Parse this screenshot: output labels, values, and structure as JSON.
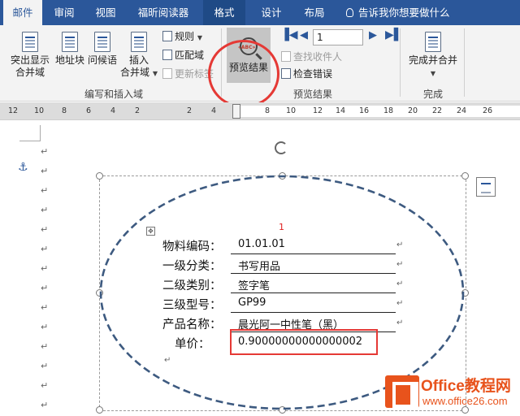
{
  "tabs": [
    {
      "label": "邮件",
      "active": true
    },
    {
      "label": "审阅"
    },
    {
      "label": "视图"
    },
    {
      "label": "福昕阅读器"
    },
    {
      "label": "格式",
      "contextual": true
    },
    {
      "label": "设计"
    },
    {
      "label": "布局"
    }
  ],
  "tell_me": "告诉我你想要做什么",
  "ribbon": {
    "highlight_fields": {
      "line1": "突出显示",
      "line2": "合并域"
    },
    "address_block": "地址块",
    "greeting_line": "问候语",
    "insert_merge_field": {
      "line1": "插入",
      "line2": "合并域"
    },
    "rules": "规则",
    "match_fields": "匹配域",
    "update_labels": "更新标签",
    "group_write_insert": "编写和插入域",
    "preview_results": "预览结果",
    "record_value": "1",
    "find_recipient": "查找收件人",
    "check_errors": "检查错误",
    "group_preview": "预览结果",
    "finish_merge": {
      "line1": "完成并合并"
    },
    "group_finish": "完成"
  },
  "ruler_numbers": [
    "12",
    "10",
    "8",
    "6",
    "4",
    "2",
    "2",
    "4",
    "8",
    "10",
    "12",
    "14",
    "16",
    "18",
    "20",
    "22",
    "24",
    "26"
  ],
  "document": {
    "page_num": "1",
    "fields": [
      {
        "label": "物料编码：",
        "value": "01.01.01"
      },
      {
        "label": "一级分类：",
        "value": "书写用品"
      },
      {
        "label": "二级类别：",
        "value": "签字笔"
      },
      {
        "label": "三级型号：",
        "value": "GP99"
      },
      {
        "label": "产品名称：",
        "value": "晨光阿一中性笔（黑）"
      },
      {
        "label": "单价：",
        "value": "0.90000000000000002"
      }
    ]
  },
  "watermark": {
    "title": "Office教程网",
    "url": "www.office26.com"
  },
  "colors": {
    "accent": "#2b579a",
    "highlight": "#e53935",
    "ellipse": "#3d5a80",
    "watermark": "#e8531c"
  }
}
